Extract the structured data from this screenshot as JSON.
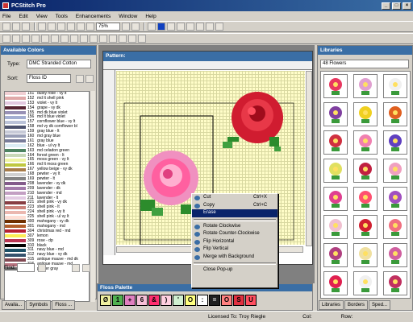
{
  "window": {
    "title": "PCStitch Pro"
  },
  "menu": [
    "File",
    "Edit",
    "View",
    "Tools",
    "Enhancements",
    "Window",
    "Help"
  ],
  "toolbar": {
    "zoom": "75%"
  },
  "left_panel": {
    "title": "Available Colors",
    "type_label": "Type:",
    "type_value": "DMC Stranded Cotton",
    "sort_label": "Sort:",
    "sort_value": "Floss ID",
    "find_label": "Find:"
  },
  "colors": [
    {
      "num": "151",
      "name": "dusty rose - vy lt",
      "c": "#f1cfd3"
    },
    {
      "num": "152",
      "name": "md lt shell pink",
      "c": "#e0a8a8"
    },
    {
      "num": "153",
      "name": "violet - vy lt",
      "c": "#e3c8e0"
    },
    {
      "num": "154",
      "name": "grape - vy dk",
      "c": "#572433"
    },
    {
      "num": "155",
      "name": "md dk blue violet",
      "c": "#9891b6"
    },
    {
      "num": "156",
      "name": "md lt blue violet",
      "c": "#a3aed1"
    },
    {
      "num": "157",
      "name": "cornflower blue - vy lt",
      "c": "#bbc3d9"
    },
    {
      "num": "158",
      "name": "md vy dk cornflower bl",
      "c": "#4c526e"
    },
    {
      "num": "159",
      "name": "gray blue - lt",
      "c": "#c7cad7"
    },
    {
      "num": "160",
      "name": "md gray blue",
      "c": "#999fb7"
    },
    {
      "num": "161",
      "name": "gray blue",
      "c": "#787c9a"
    },
    {
      "num": "162",
      "name": "blue - ul vy lt",
      "c": "#dbecf5"
    },
    {
      "num": "163",
      "name": "md celadon green",
      "c": "#4d8361"
    },
    {
      "num": "164",
      "name": "forest green - lt",
      "c": "#c8d8b8"
    },
    {
      "num": "165",
      "name": "moss green - vy lt",
      "c": "#eff4a4"
    },
    {
      "num": "166",
      "name": "md lt moss green",
      "c": "#c0c840"
    },
    {
      "num": "167",
      "name": "yellow beige - vy dk",
      "c": "#a77c49"
    },
    {
      "num": "168",
      "name": "pewter - vy lt",
      "c": "#d1d1d1"
    },
    {
      "num": "169",
      "name": "pewter - lt",
      "c": "#848484"
    },
    {
      "num": "208",
      "name": "lavender - vy dk",
      "c": "#835b8b"
    },
    {
      "num": "209",
      "name": "lavender - dk",
      "c": "#a37bab"
    },
    {
      "num": "210",
      "name": "lavender - md",
      "c": "#c39fc3"
    },
    {
      "num": "211",
      "name": "lavender - lt",
      "c": "#e3cbe3"
    },
    {
      "num": "221",
      "name": "shell pink - vy dk",
      "c": "#883e43"
    },
    {
      "num": "223",
      "name": "shell pink - lt",
      "c": "#cc847c"
    },
    {
      "num": "224",
      "name": "shell pink - vy lt",
      "c": "#ebb7af"
    },
    {
      "num": "225",
      "name": "shell pink - ul vy lt",
      "c": "#ffdfd5"
    },
    {
      "num": "300",
      "name": "mahogany - vy dk",
      "c": "#6f2f00"
    },
    {
      "num": "301",
      "name": "mahogany - md",
      "c": "#b35f2b"
    },
    {
      "num": "304",
      "name": "christmas red - md",
      "c": "#b71f33"
    },
    {
      "num": "307",
      "name": "lemon",
      "c": "#fded54"
    },
    {
      "num": "309",
      "name": "rose - dp",
      "c": "#bb3352"
    },
    {
      "num": "310",
      "name": "black",
      "c": "#000000"
    },
    {
      "num": "311",
      "name": "navy blue - md",
      "c": "#1c5066"
    },
    {
      "num": "312",
      "name": "navy blue - vy dk",
      "c": "#35526d"
    },
    {
      "num": "315",
      "name": "antique mauve - md dk",
      "c": "#814952"
    },
    {
      "num": "316",
      "name": "antique mauve - md",
      "c": "#b7737f"
    },
    {
      "num": "317",
      "name": "pewter gray",
      "c": "#6c6c6c"
    }
  ],
  "pattern_window": {
    "title": "Pattern:"
  },
  "context_menu": {
    "items": [
      {
        "label": "Cut",
        "shortcut": "Ctrl+X"
      },
      {
        "label": "Copy",
        "shortcut": "Ctrl+C"
      },
      {
        "label": "Erase",
        "shortcut": ""
      },
      {
        "label": "Rotate Clockwise",
        "shortcut": ""
      },
      {
        "label": "Rotate Counter-Clockwise",
        "shortcut": ""
      },
      {
        "label": "Flip Horizontal",
        "shortcut": ""
      },
      {
        "label": "Flip Vertical",
        "shortcut": ""
      },
      {
        "label": "Merge with Background",
        "shortcut": ""
      },
      {
        "label": "Close Pop-up",
        "shortcut": ""
      }
    ]
  },
  "floss_palette": {
    "title": "Floss Palette",
    "symbols": [
      {
        "s": "Ø",
        "c": "#f0f0a0"
      },
      {
        "s": "1",
        "c": "#50b050"
      },
      {
        "s": "+",
        "c": "#e080c0"
      },
      {
        "s": "6",
        "c": "#f7c0d8"
      },
      {
        "s": "&",
        "c": "#ff3070"
      },
      {
        "s": ")",
        "c": "#ffd0e0"
      },
      {
        "s": "'",
        "c": "#d0f0d0"
      },
      {
        "s": "O",
        "c": "#ffff80"
      },
      {
        "s": ":",
        "c": "#ffffff"
      },
      {
        "s": "=",
        "c": "#202020"
      },
      {
        "s": "O",
        "c": "#ff8080"
      },
      {
        "s": "S",
        "c": "#e03040"
      },
      {
        "s": "U",
        "c": "#ff5060"
      }
    ]
  },
  "libraries": {
    "title": "Libraries",
    "selector": "48 Flowers"
  },
  "bottom_tabs_left": [
    "Availa...",
    "Symbols",
    "Floss ..."
  ],
  "bottom_tabs_right": [
    "Libraries",
    "Borders",
    "Sped..."
  ],
  "status": {
    "licensed": "Licensed To: Troy Riegle",
    "col": "Col:",
    "row": "Row:"
  }
}
